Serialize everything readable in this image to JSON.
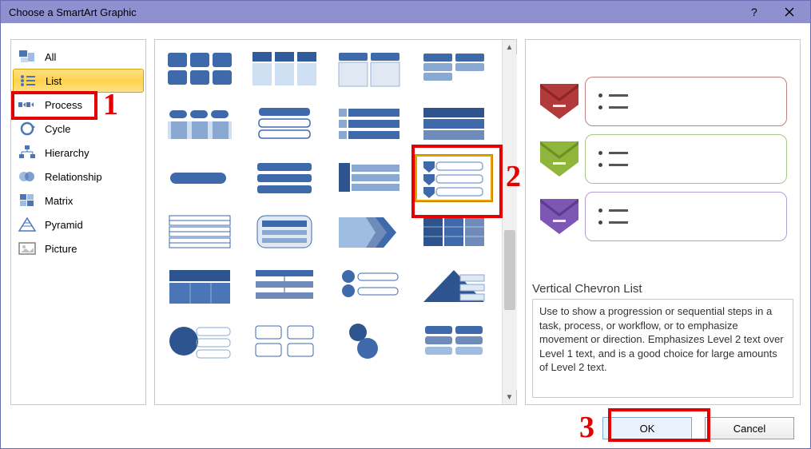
{
  "titlebar": {
    "title": "Choose a SmartArt Graphic",
    "help_icon": "help-icon",
    "close_icon": "close-icon"
  },
  "sidebar": {
    "items": [
      {
        "label": "All"
      },
      {
        "label": "List"
      },
      {
        "label": "Process"
      },
      {
        "label": "Cycle"
      },
      {
        "label": "Hierarchy"
      },
      {
        "label": "Relationship"
      },
      {
        "label": "Matrix"
      },
      {
        "label": "Pyramid"
      },
      {
        "label": "Picture"
      }
    ],
    "selected_index": 1
  },
  "preview": {
    "title": "Vertical Chevron List",
    "description": "Use to show a progression or sequential steps in a task, process, or workflow, or to emphasize movement or direction. Emphasizes Level 2 text over Level 1 text, and is a good choice for large amounts of Level 2 text."
  },
  "buttons": {
    "ok_label": "OK",
    "cancel_label": "Cancel"
  },
  "annotations": {
    "n1": "1",
    "n2": "2",
    "n3": "3"
  },
  "colors": {
    "accent": "#3e6aac",
    "secondary": "#6f8bb9",
    "red": "#b33a3a",
    "green": "#8fb53a",
    "purple": "#7e57b4"
  }
}
